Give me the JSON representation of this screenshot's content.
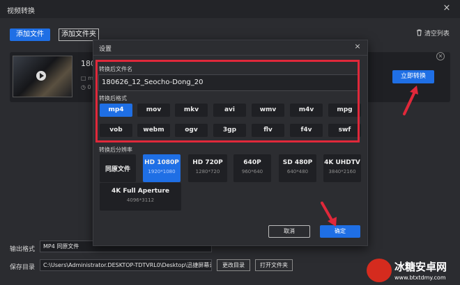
{
  "window": {
    "title": "视频转换",
    "close": "×"
  },
  "toolbar": {
    "add_file": "添加文件",
    "add_folder": "添加文件夹",
    "clear_list": "清空列表",
    "clear_icon": "trash-icon"
  },
  "file_card": {
    "name_short": "180",
    "meta1": "□ m",
    "meta2": "◷ 0",
    "convert_now": "立即转换"
  },
  "bottom": {
    "output_format_label": "输出格式",
    "output_format_value": "MP4 同原文件",
    "save_dir_label": "保存目录",
    "save_dir_value": "C:\\Users\\Administrator.DESKTOP-TDTVRL0\\Desktop\\迅捷屏幕录像工",
    "change_dir": "更改目录",
    "open_folder": "打开文件夹"
  },
  "dialog": {
    "title": "设置",
    "close": "×",
    "name_label": "转换后文件名",
    "name_value": "180626_12_Seocho-Dong_20",
    "format_label": "转换后格式",
    "formats": [
      "mp4",
      "mov",
      "mkv",
      "avi",
      "wmv",
      "m4v",
      "mpg",
      "vob",
      "webm",
      "ogv",
      "3gp",
      "flv",
      "f4v",
      "swf"
    ],
    "selected_format": "mp4",
    "resolution_label": "转换后分辨率",
    "resolutions": [
      {
        "name": "同原文件",
        "dim": ""
      },
      {
        "name": "HD 1080P",
        "dim": "1920*1080"
      },
      {
        "name": "HD 720P",
        "dim": "1280*720"
      },
      {
        "name": "640P",
        "dim": "960*640"
      },
      {
        "name": "SD 480P",
        "dim": "640*480"
      },
      {
        "name": "4K UHDTV",
        "dim": "3840*2160"
      },
      {
        "name": "4K Full Aperture",
        "dim": "4096*3112"
      }
    ],
    "selected_resolution": "HD 1080P",
    "cancel": "取消",
    "ok": "确定"
  },
  "watermark": {
    "text": "冰糖安卓网",
    "url": "www.btxtdmy.com"
  },
  "colors": {
    "accent": "#1f6fe5",
    "highlight": "#e0283a",
    "background": "#2b2c30"
  }
}
